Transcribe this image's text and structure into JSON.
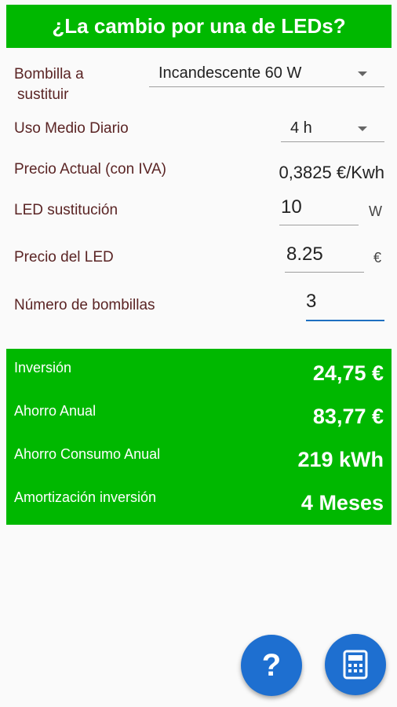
{
  "header": {
    "title": "¿La cambio por una de LEDs?"
  },
  "form": {
    "bulb_label_line1": "Bombilla a",
    "bulb_label_line2": "sustituir",
    "bulb_value": "Incandescente 60 W",
    "usage_label": "Uso Medio Diario",
    "usage_value": "4 h",
    "price_label": "Precio Actual (con IVA)",
    "price_value": "0,3825 €/Kwh",
    "led_label": "LED sustitución",
    "led_value": "10",
    "led_unit": "W",
    "led_price_label": "Precio del LED",
    "led_price_value": "8.25",
    "led_price_unit": "€",
    "count_label": "Número de bombillas",
    "count_value": "3"
  },
  "results": {
    "investment_label": "Inversión",
    "investment_value": "24,75 €",
    "annual_savings_label": "Ahorro Anual",
    "annual_savings_value": "83,77 €",
    "consumption_savings_label": "Ahorro Consumo Anual",
    "consumption_savings_value": "219 kWh",
    "amortization_label": "Amortización inversión",
    "amortization_value": "4 Meses"
  },
  "fabs": {
    "help_icon": "question-icon",
    "help_label": "?",
    "calc_icon": "calculator-icon"
  },
  "colors": {
    "accent_green": "#00b800",
    "fab_blue": "#1e6fd0",
    "label_brown": "#5a2424"
  }
}
